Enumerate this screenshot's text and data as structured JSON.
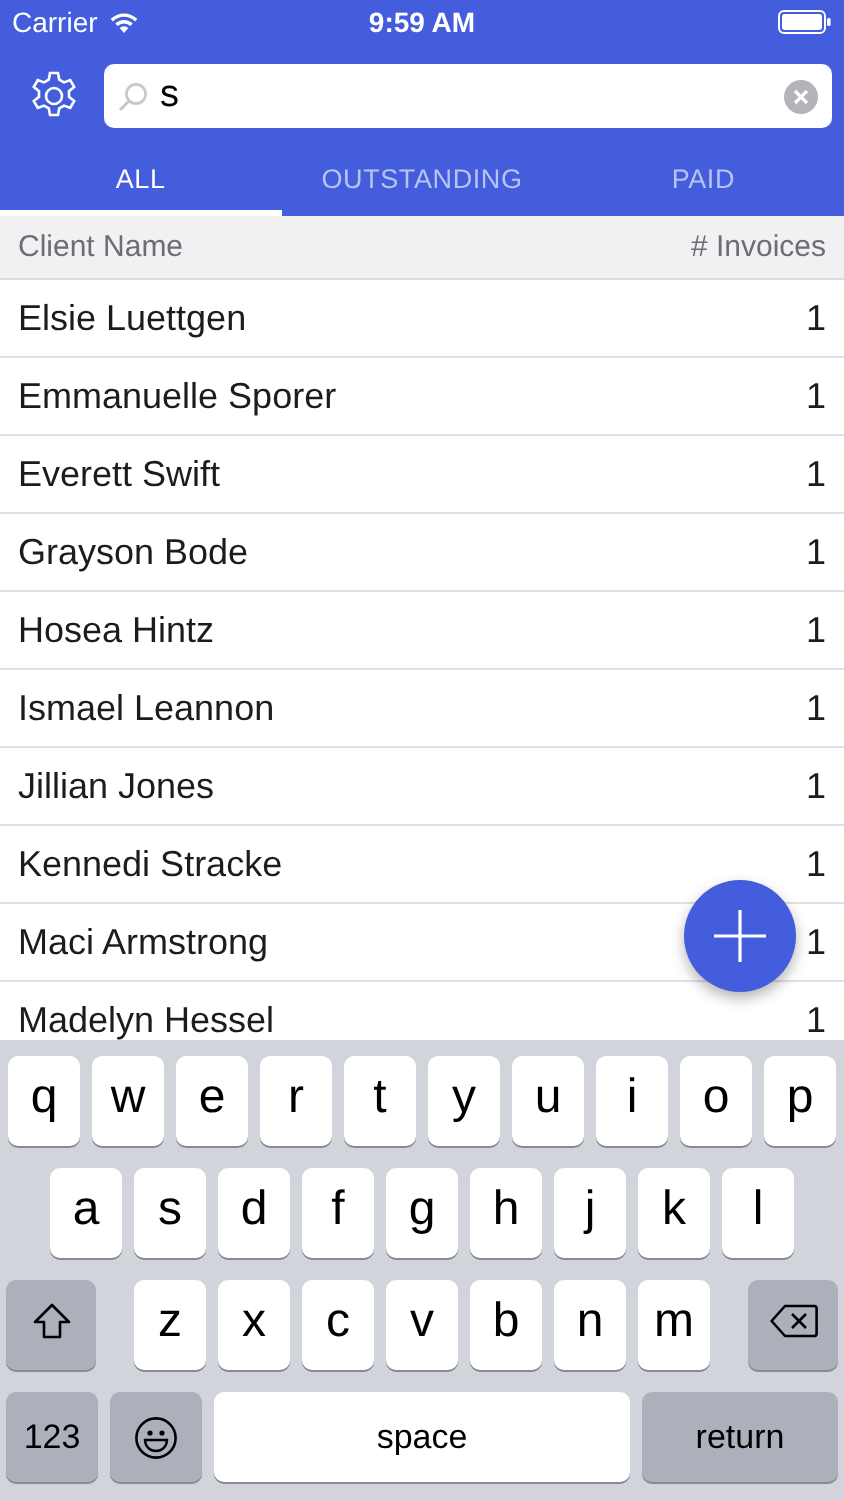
{
  "status_bar": {
    "carrier": "Carrier",
    "time": "9:59 AM"
  },
  "search": {
    "value": "s"
  },
  "tabs": [
    {
      "label": "ALL",
      "selected": true
    },
    {
      "label": "OUTSTANDING",
      "selected": false
    },
    {
      "label": "PAID",
      "selected": false
    }
  ],
  "table": {
    "columns": [
      "Client Name",
      "# Invoices"
    ],
    "rows": [
      {
        "name": "Elsie Luettgen",
        "invoices": "1"
      },
      {
        "name": "Emmanuelle Sporer",
        "invoices": "1"
      },
      {
        "name": "Everett Swift",
        "invoices": "1"
      },
      {
        "name": "Grayson Bode",
        "invoices": "1"
      },
      {
        "name": "Hosea Hintz",
        "invoices": "1"
      },
      {
        "name": "Ismael Leannon",
        "invoices": "1"
      },
      {
        "name": "Jillian Jones",
        "invoices": "1"
      },
      {
        "name": "Kennedi Stracke",
        "invoices": "1"
      },
      {
        "name": "Maci Armstrong",
        "invoices": "1"
      },
      {
        "name": "Madelyn Hessel",
        "invoices": "1"
      }
    ]
  },
  "keyboard": {
    "letter_rows": [
      [
        {
          "kind": "letter",
          "label": "q"
        },
        {
          "kind": "letter",
          "label": "w"
        },
        {
          "kind": "letter",
          "label": "e"
        },
        {
          "kind": "letter",
          "label": "r"
        },
        {
          "kind": "letter",
          "label": "t"
        },
        {
          "kind": "letter",
          "label": "y"
        },
        {
          "kind": "letter",
          "label": "u"
        },
        {
          "kind": "letter",
          "label": "i"
        },
        {
          "kind": "letter",
          "label": "o"
        },
        {
          "kind": "letter",
          "label": "p"
        }
      ],
      [
        {
          "kind": "letter",
          "label": "a"
        },
        {
          "kind": "letter",
          "label": "s"
        },
        {
          "kind": "letter",
          "label": "d"
        },
        {
          "kind": "letter",
          "label": "f"
        },
        {
          "kind": "letter",
          "label": "g"
        },
        {
          "kind": "letter",
          "label": "h"
        },
        {
          "kind": "letter",
          "label": "j"
        },
        {
          "kind": "letter",
          "label": "k"
        },
        {
          "kind": "letter",
          "label": "l"
        }
      ],
      [
        {
          "kind": "shift"
        },
        {
          "kind": "letter",
          "label": "z"
        },
        {
          "kind": "letter",
          "label": "x"
        },
        {
          "kind": "letter",
          "label": "c"
        },
        {
          "kind": "letter",
          "label": "v"
        },
        {
          "kind": "letter",
          "label": "b"
        },
        {
          "kind": "letter",
          "label": "n"
        },
        {
          "kind": "letter",
          "label": "m"
        },
        {
          "kind": "delete"
        }
      ]
    ],
    "bottom_row": [
      {
        "kind": "mode",
        "label": "123"
      },
      {
        "kind": "emoji"
      },
      {
        "kind": "space",
        "label": "space"
      },
      {
        "kind": "return",
        "label": "return"
      }
    ]
  }
}
